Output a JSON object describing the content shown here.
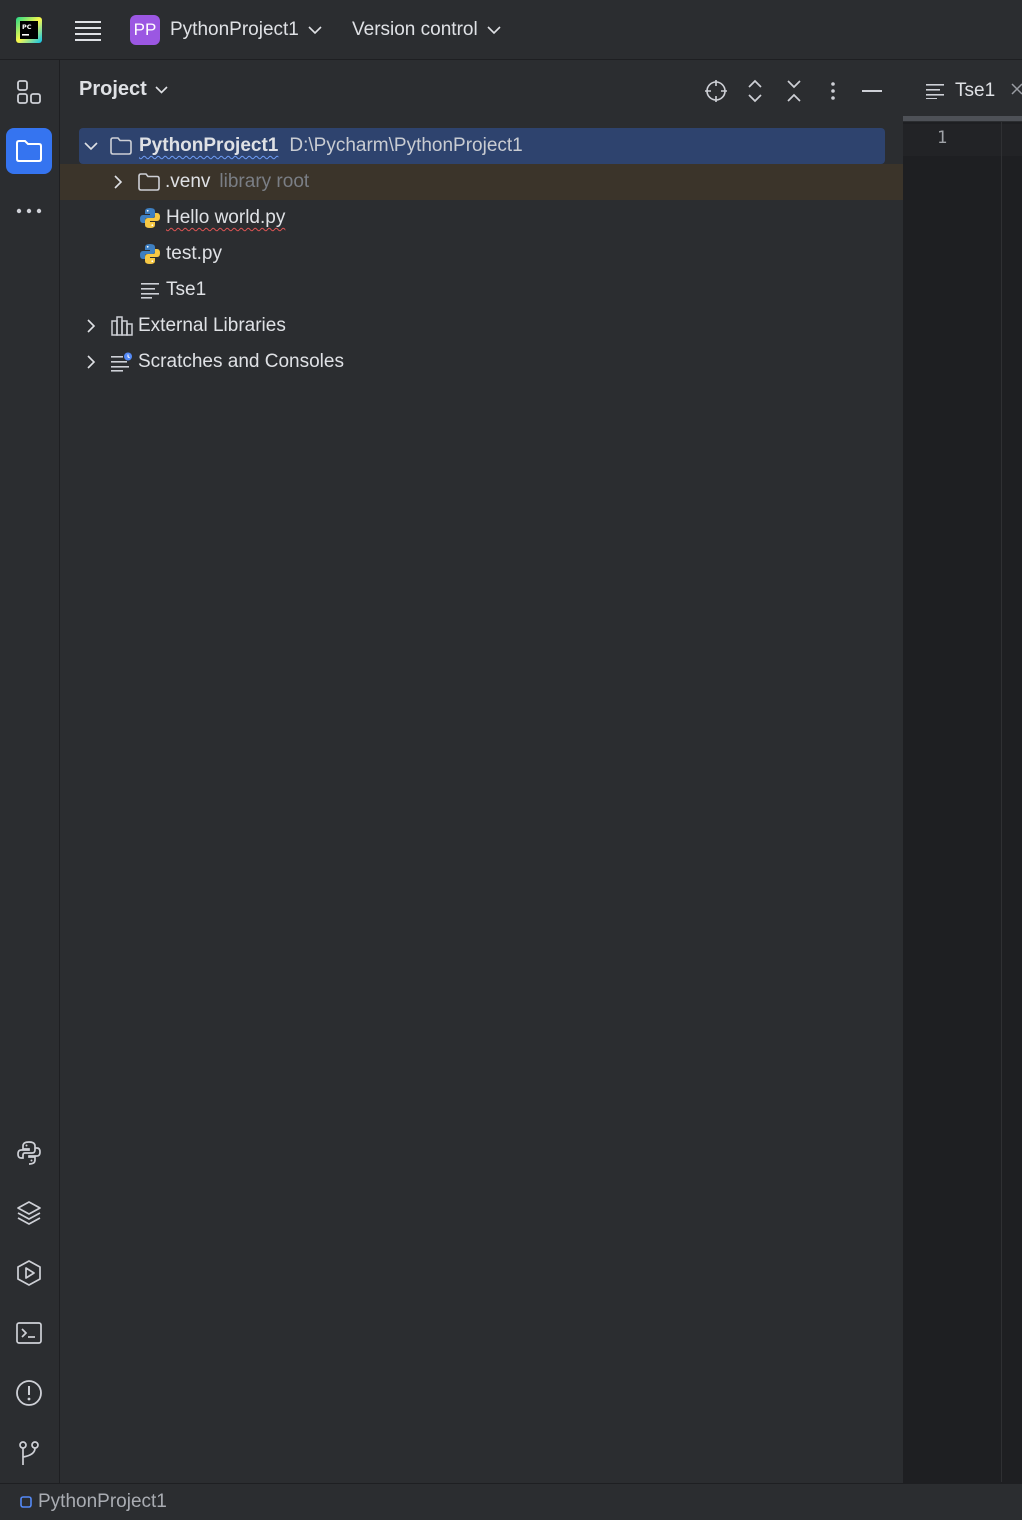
{
  "titlebar": {
    "project_badge": "PP",
    "project_name": "PythonProject1",
    "vcs_label": "Version control"
  },
  "project_panel": {
    "title": "Project",
    "tree": {
      "root": {
        "name": "PythonProject1",
        "path": "D:\\Pycharm\\PythonProject1"
      },
      "venv": {
        "name": ".venv",
        "hint": "library root"
      },
      "files": [
        {
          "name": "Hello world.py",
          "icon": "python-file-icon"
        },
        {
          "name": "test.py",
          "icon": "python-file-icon"
        },
        {
          "name": "Tse1",
          "icon": "text-file-icon"
        }
      ],
      "external_libraries": "External Libraries",
      "scratches": "Scratches and Consoles"
    }
  },
  "editor": {
    "tab_label": "Tse1",
    "line_number": "1"
  },
  "statusbar": {
    "breadcrumb": "PythonProject1"
  },
  "colors": {
    "accent": "#3574f0",
    "selection": "#2e436e",
    "project_badge": "#9b57e2",
    "venv_row": "#3b342a"
  }
}
